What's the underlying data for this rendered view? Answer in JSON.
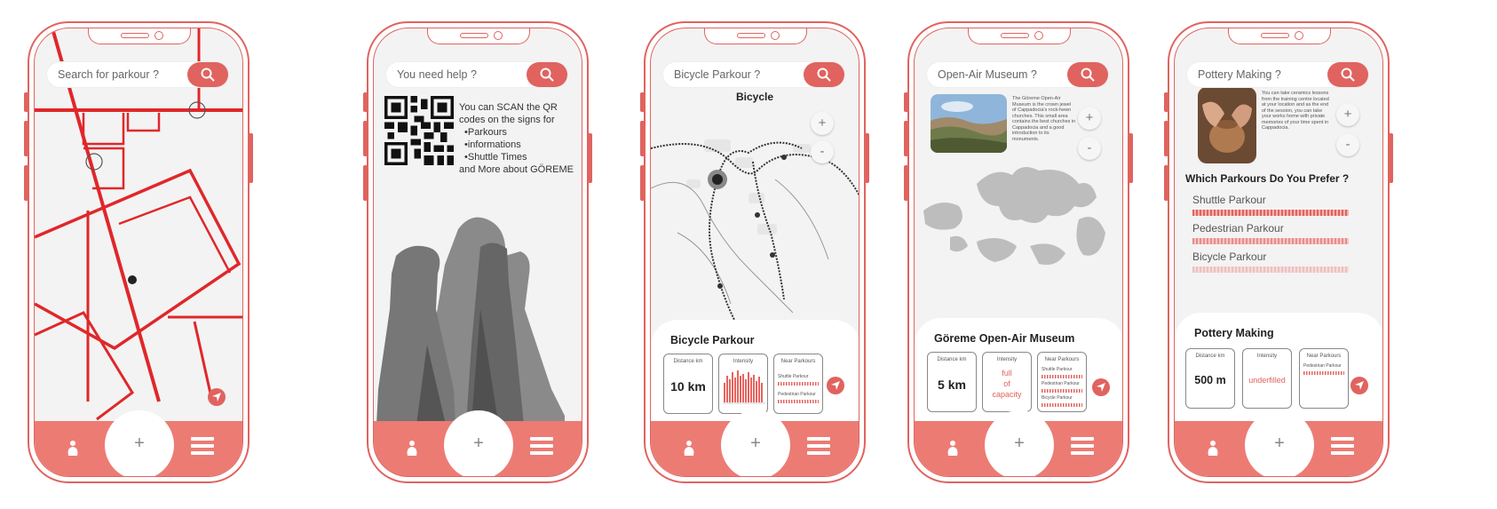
{
  "screens": [
    {
      "search_placeholder": "Search for parkour ?"
    },
    {
      "search_placeholder": "You need help ?",
      "help_text": {
        "line1": "You can SCAN the QR",
        "line2": "codes on the signs for",
        "item1": "•Parkours",
        "item2": "•informations",
        "item3": "•Shuttle Times",
        "line3": "and More about GÖREME"
      }
    },
    {
      "search_placeholder": "Bicycle Parkour ?",
      "map_label": "Bicycle",
      "sheet_title": "Bicycle Parkour",
      "card1_label": "Distance km",
      "card1_value": "10 km",
      "card2_label": "Intensity",
      "card3_label": "Near Parkours",
      "card3_items": [
        "Shuttle Parkour",
        "Pedestrian Parkour"
      ]
    },
    {
      "search_placeholder": "Open-Air Museum ?",
      "description": "The Göreme Open-Air Museum is the crown jewel of Cappadocia's rock-hewn churches. This small area contains the best churches in Cappadocia and a good introduction to its monuments.",
      "sheet_title": "Göreme Open-Air Museum",
      "card1_label": "Distance km",
      "card1_value": "5 km",
      "card2_label": "Intensity",
      "card2_value_lines": [
        "full",
        "of",
        "capacity"
      ],
      "card3_label": "Near Parkours",
      "card3_items": [
        "Shuttle Parkour",
        "Pedestrian Parkour",
        "Bicycle Parkour"
      ]
    },
    {
      "search_placeholder": "Pottery Making ?",
      "description": "You can take ceramics lessons from the training centre located at your location and as the end of the session, you can take your works home with private memories of your time spent in Cappadocia.",
      "question": "Which Parkours Do You Prefer ?",
      "options": [
        "Shuttle Parkour",
        "Pedestrian Parkour",
        "Bicycle Parkour"
      ],
      "sheet_title": "Pottery Making",
      "card1_label": "Distance km",
      "card1_value": "500 m",
      "card2_label": "Intensity",
      "card2_value": "underfilled",
      "card3_label": "Near Parkours",
      "card3_items": [
        "Pedestrian Parkour"
      ]
    }
  ],
  "common": {
    "zoom_in": "+",
    "zoom_out": "-",
    "tab_add": "+"
  },
  "colors": {
    "accent": "#e0635f",
    "tabbar": "#ec7b74",
    "screen_bg": "#f3f3f3"
  }
}
